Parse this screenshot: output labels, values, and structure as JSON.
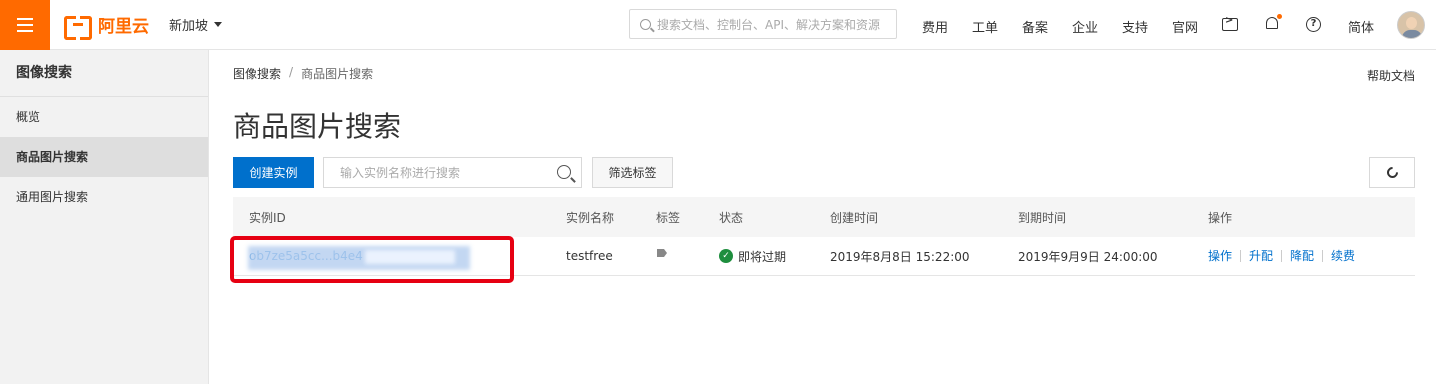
{
  "topbar": {
    "logo_text": "阿里云",
    "region": "新加坡",
    "search_placeholder": "搜索文档、控制台、API、解决方案和资源",
    "nav": [
      "费用",
      "工单",
      "备案",
      "企业",
      "支持",
      "官网"
    ],
    "lang": "简体"
  },
  "sidebar": {
    "title": "图像搜索",
    "items": [
      {
        "label": "概览"
      },
      {
        "label": "商品图片搜索"
      },
      {
        "label": "通用图片搜索"
      }
    ]
  },
  "breadcrumb": {
    "root": "图像搜索",
    "sep": "/",
    "current": "商品图片搜索"
  },
  "help_doc": "帮助文档",
  "page_title": "商品图片搜索",
  "toolbar": {
    "create_label": "创建实例",
    "search_placeholder": "输入实例名称进行搜索",
    "filter_label": "筛选标签"
  },
  "table": {
    "headers": [
      "实例ID",
      "实例名称",
      "标签",
      "状态",
      "创建时间",
      "到期时间",
      "操作"
    ],
    "rows": [
      {
        "id": "ob7ze5a5cc...b4e4",
        "name": "testfree",
        "status": "即将过期",
        "created": "2019年8月8日 15:22:00",
        "expires": "2019年9月9日 24:00:00",
        "actions": [
          "操作",
          "升配",
          "降配",
          "续费"
        ]
      }
    ]
  },
  "colors": {
    "brand": "#ff6a00",
    "primary": "#0070cc",
    "highlight": "#e60012",
    "status_ok": "#1e8e3e"
  }
}
